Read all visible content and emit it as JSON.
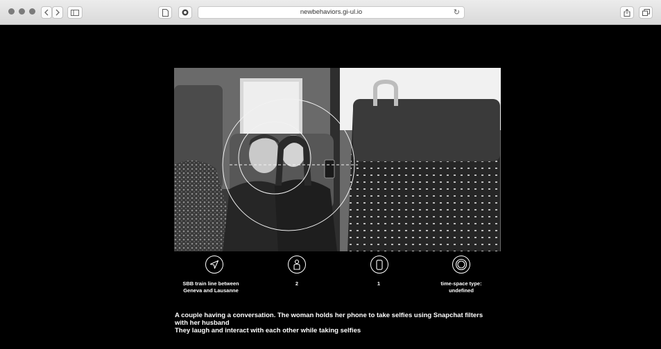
{
  "browser": {
    "url": "newbehaviors.gi-ul.io",
    "icons": {
      "back": "chevron-left-icon",
      "forward": "chevron-right-icon",
      "sidebar": "sidebar-icon",
      "reader": "page-icon",
      "extension": "shield-icon",
      "reload": "reload-icon",
      "share": "share-icon",
      "tabs": "tabs-icon"
    },
    "reload_glyph": "↻"
  },
  "observation": {
    "photo_description": "",
    "meta": [
      {
        "icon": "location-arrow-icon",
        "label_line1": "SBB train line between",
        "label_line2": "Geneva and Lausanne"
      },
      {
        "icon": "person-icon",
        "label_line1": "2",
        "label_line2": ""
      },
      {
        "icon": "phone-icon",
        "label_line1": "1",
        "label_line2": ""
      },
      {
        "icon": "target-circle-icon",
        "label_line1": "time-space type:",
        "label_line2": "undefined"
      }
    ],
    "description_line1": "A couple having a conversation. The woman holds her phone to take selfies using Snapchat filters",
    "description_line2": "with her husband",
    "description_line3": "They laugh and interact with each other while taking selfies"
  }
}
